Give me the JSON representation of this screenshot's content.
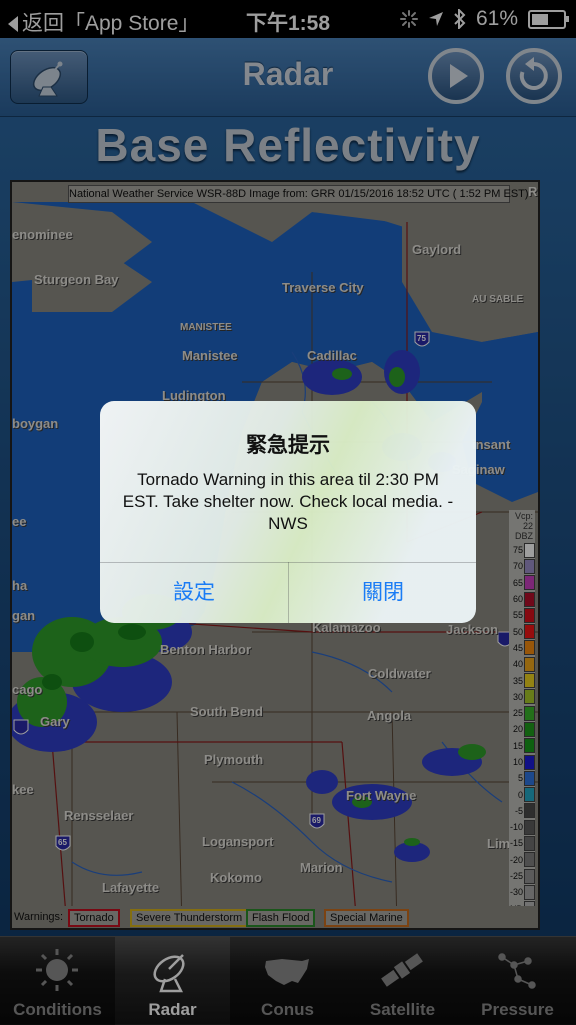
{
  "status_bar": {
    "back_label": "返回「App Store」",
    "time": "下午1:58",
    "battery": "61%",
    "battery_level": 0.61
  },
  "navbar": {
    "title": "Radar",
    "left_icon": "radar-dish-icon",
    "play_icon": "play-icon",
    "refresh_icon": "refresh-icon"
  },
  "headline": "Base Reflectivity",
  "radar": {
    "header": "National Weather Service WSR-88D Image from: GRR 01/15/2016 18:52 UTC ( 1:52 PM EST)",
    "cities": [
      "enominee",
      "Sturgeon Bay",
      "Gaylord",
      "Traverse City",
      "AU SABLE",
      "MANISTEE",
      "Manistee",
      "Cadillac",
      "Ludington",
      "boygan",
      "Saginaw",
      "insant",
      "ee",
      "Kalamazoo",
      "Jackson",
      "Benton Harbor",
      "Coldwater",
      "cago",
      "Gary",
      "South Bend",
      "Angola",
      "Plymouth",
      "kee",
      "Fort Wayne",
      "Rensselaer",
      "Logansport",
      "Marion",
      "Lima",
      "Kokomo",
      "Lafayette",
      "gan",
      "ha",
      "Roge"
    ],
    "interstates": [
      "75",
      "69",
      "65"
    ],
    "scale_header": "Vcp: 22 DBZ",
    "scale_labels": [
      "75",
      "70",
      "65",
      "60",
      "55",
      "50",
      "45",
      "40",
      "35",
      "30",
      "25",
      "20",
      "15",
      "10",
      "5",
      "0",
      "-5",
      "-10",
      "-15",
      "-20",
      "-25",
      "-30",
      "ND"
    ],
    "scale_colors": [
      "#ffffff",
      "#9b8fc8",
      "#c93fc0",
      "#b4102a",
      "#d90f1b",
      "#f21616",
      "#f58c10",
      "#f0a61a",
      "#eed21f",
      "#a8c82a",
      "#39b42a",
      "#1f9c1c",
      "#189b1b",
      "#1c1cd9",
      "#2f74e0",
      "#24a8c6",
      "#4b4b4b",
      "#5d5d5d",
      "#6e6e6e",
      "#808080",
      "#939393",
      "#a6a6a6",
      "#b9b9b9"
    ],
    "warnings_label": "Warnings:",
    "warnings": [
      {
        "label": "Tornado",
        "color": "#c40f1f"
      },
      {
        "label": "Severe Thunderstorm",
        "color": "#d6b21a"
      },
      {
        "label": "Flash Flood",
        "color": "#2a8c2a"
      },
      {
        "label": "Special Marine",
        "color": "#c86d1d"
      }
    ]
  },
  "alert": {
    "title": "緊急提示",
    "message": "Tornado Warning in this area til 2:30 PM EST. Take shelter now. Check local media. -NWS",
    "left_button": "設定",
    "right_button": "關閉"
  },
  "tabbar": {
    "tabs": [
      {
        "label": "Conditions",
        "icon": "sun-icon",
        "active": false
      },
      {
        "label": "Radar",
        "icon": "radar-dish-icon",
        "active": true
      },
      {
        "label": "Conus",
        "icon": "usa-map-icon",
        "active": false
      },
      {
        "label": "Satellite",
        "icon": "satellite-icon",
        "active": false
      },
      {
        "label": "Pressure",
        "icon": "constellation-icon",
        "active": false
      }
    ]
  }
}
